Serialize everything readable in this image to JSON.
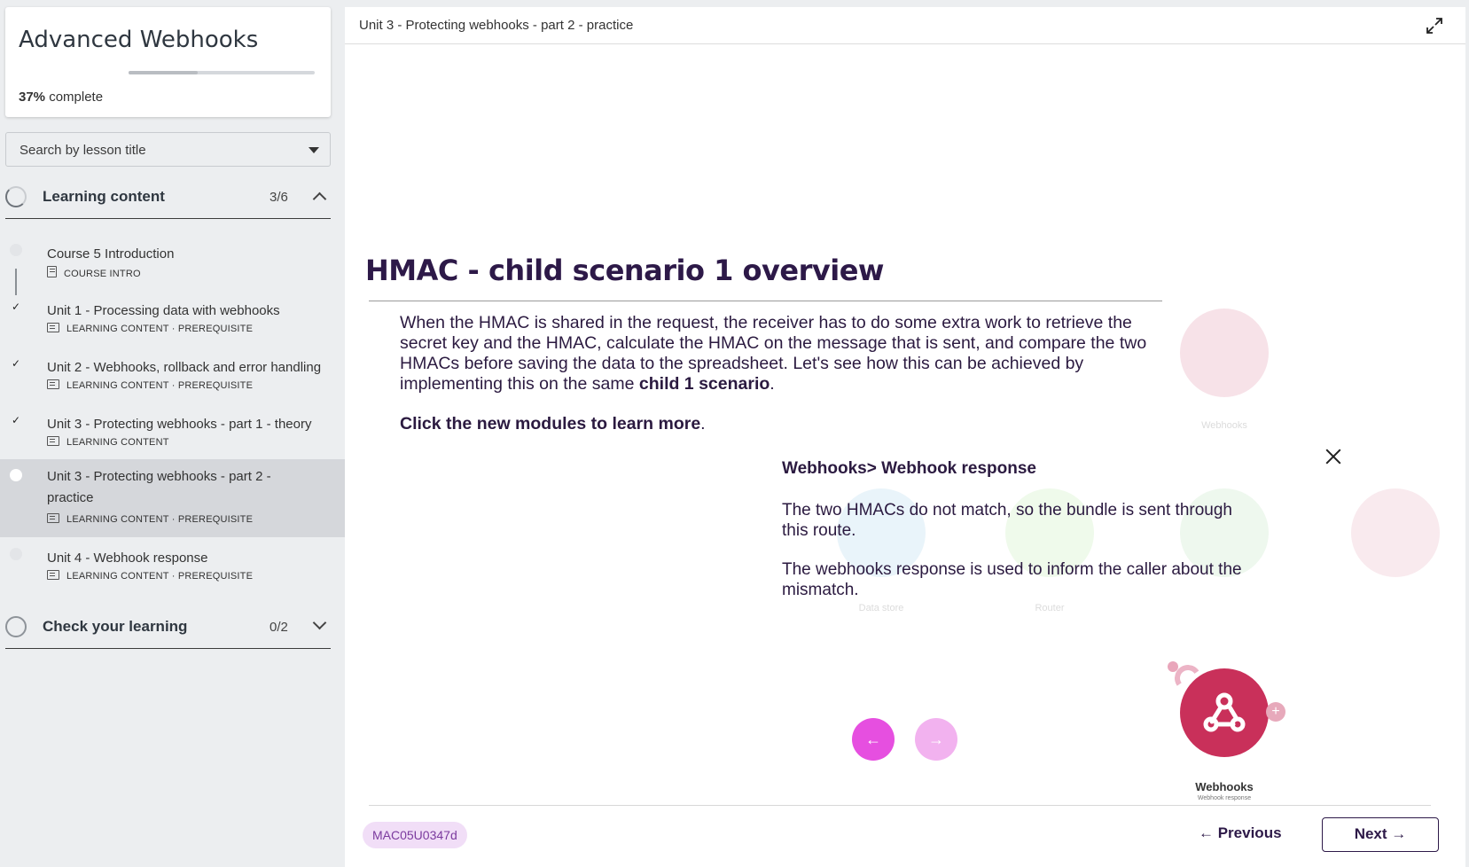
{
  "course": {
    "title": "Advanced Webhooks",
    "progress_percent": "37%",
    "progress_suffix": " complete",
    "progress_fraction": 0.37
  },
  "search": {
    "placeholder": "Search by lesson title"
  },
  "sections": [
    {
      "title": "Learning content",
      "count": "3/6",
      "expanded": true
    },
    {
      "title": "Check your learning",
      "count": "0/2",
      "expanded": false
    }
  ],
  "lessons": [
    {
      "title": "Course 5 Introduction",
      "meta": "COURSE INTRO",
      "status": "not-started"
    },
    {
      "title": "Unit 1 - Processing data with webhooks",
      "meta": "LEARNING CONTENT · PREREQUISITE",
      "status": "done"
    },
    {
      "title": "Unit 2 - Webhooks, rollback and error handling",
      "meta": "LEARNING CONTENT · PREREQUISITE",
      "status": "done"
    },
    {
      "title": "Unit 3 - Protecting webhooks - part 1 - theory",
      "meta": "LEARNING CONTENT",
      "status": "done"
    },
    {
      "title": "Unit 3 - Protecting webhooks - part 2 - practice",
      "meta": "LEARNING CONTENT · PREREQUISITE",
      "status": "current"
    },
    {
      "title": "Unit 4 - Webhook response",
      "meta": "LEARNING CONTENT · PREREQUISITE",
      "status": "not-started"
    }
  ],
  "check_glyph": "✓",
  "main": {
    "breadcrumb": "Unit 3 - Protecting webhooks - part 2 - practice",
    "slide_title": "HMAC - child scenario 1 overview",
    "body_before_bold": "When the HMAC is shared in the request, the receiver has to do some extra work to retrieve the secret key and the HMAC, calculate the HMAC on the message that is sent, and compare the two HMACs before saving the data to the spreadsheet. Let's see how this can be achieved by implementing this on the same ",
    "body_bold": "child 1 scenario",
    "body_after_bold": ".",
    "cta_bold": "Click the new modules to learn more",
    "cta_after": "."
  },
  "popup": {
    "title": "Webhooks> Webhook response",
    "p1": "The two HMACs do not match, so the bundle is sent through this route.",
    "p2": "The webhooks response is used to inform the caller about the mismatch."
  },
  "diagram": {
    "module_name": "Webhooks",
    "module_sub": "Webhook response",
    "plus": "+",
    "ghost_labels": [
      "Webhooks",
      "Data store",
      "Router"
    ]
  },
  "slide_nav": {
    "prev_glyph": "←",
    "next_glyph": "→"
  },
  "footer": {
    "code": "MAC05U0347d",
    "previous_label": "← Previous",
    "next_label": "Next →"
  },
  "colors": {
    "accent_magenta": "#e64fe0",
    "accent_magenta_light": "#f2b2ef",
    "webhooks_red": "#c9305a",
    "title_purple": "#2d1948"
  }
}
